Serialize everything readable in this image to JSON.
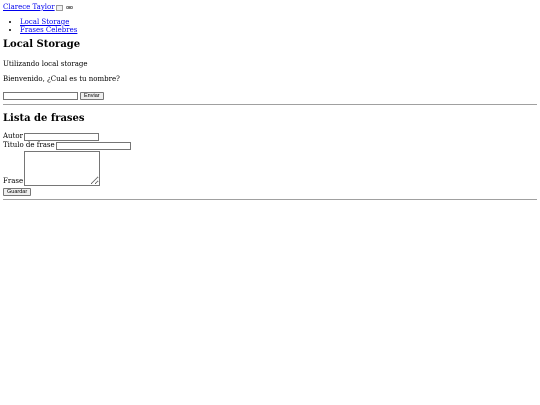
{
  "navbar": {
    "brand": "Clarece Taylor"
  },
  "nav": {
    "items": [
      {
        "label": "Local Storage"
      },
      {
        "label": "Frases Celebres"
      }
    ]
  },
  "main": {
    "title": "Local Storage",
    "subtitle": "Utilizando local storage",
    "greeting": "Bienvenido, ¿Cual es tu nombre?",
    "name_input_value": "",
    "submit_label": "Enviar"
  },
  "lista": {
    "title": "Lista de frases",
    "author_label": "Autor",
    "author_value": "",
    "title_label": "Titulo de frase",
    "title_value": "",
    "phrase_label": "Frase",
    "phrase_value": "",
    "save_label": "Guardar"
  }
}
